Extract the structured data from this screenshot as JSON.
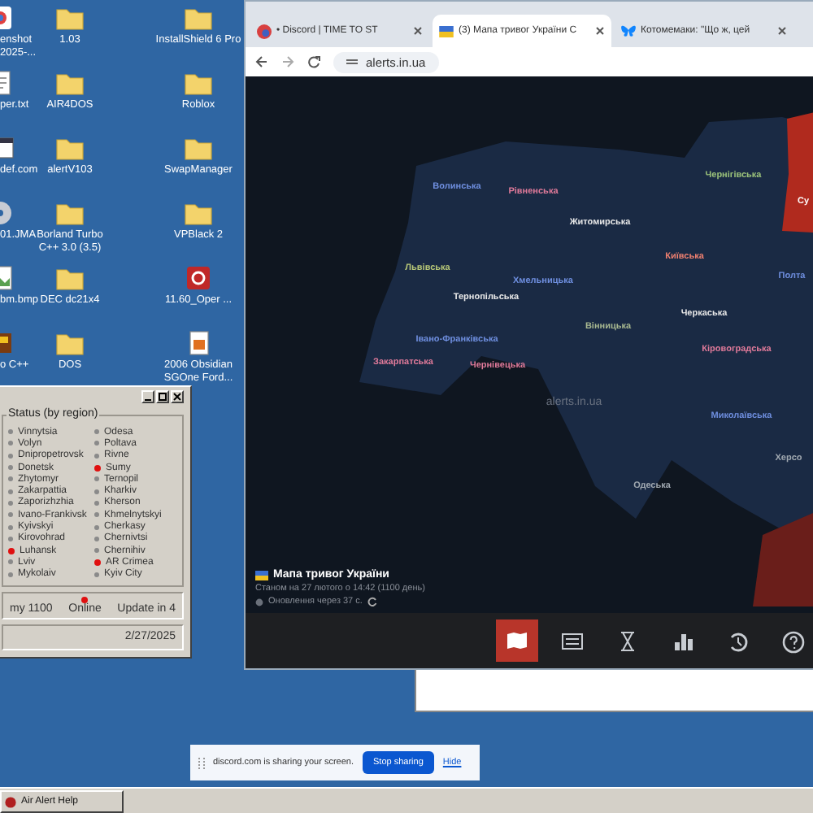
{
  "desktop_icons": [
    {
      "label": "enshot 2025-...",
      "kind": "screenshot"
    },
    {
      "label": "per.txt",
      "kind": "text"
    },
    {
      "label": "def.com",
      "kind": "program"
    },
    {
      "label": "01.JMA",
      "kind": "disc"
    },
    {
      "label": "bm.bmp",
      "kind": "image"
    },
    {
      "label": "o C++",
      "kind": "game"
    },
    {
      "label": "1.03",
      "kind": "folder"
    },
    {
      "label": "AIR4DOS",
      "kind": "folder"
    },
    {
      "label": "alertV103",
      "kind": "folder"
    },
    {
      "label": "Borland Turbo C++ 3.0 (3.5)",
      "kind": "folder"
    },
    {
      "label": "DEC dc21x4",
      "kind": "folder"
    },
    {
      "label": "DOS",
      "kind": "folder"
    },
    {
      "label": "InstallShield 6 Pro",
      "kind": "folder"
    },
    {
      "label": "Roblox",
      "kind": "folder"
    },
    {
      "label": "SwapManager",
      "kind": "folder"
    },
    {
      "label": "VPBlack 2",
      "kind": "folder"
    },
    {
      "label": "11.60_Oper ...",
      "kind": "redapp"
    },
    {
      "label": "2006 Obsidian SGOne Ford...",
      "kind": "document"
    }
  ],
  "alert_window": {
    "group_title": "Status (by region)",
    "regions": [
      {
        "name": "Vinnytsia",
        "alert": false
      },
      {
        "name": "Volyn",
        "alert": false
      },
      {
        "name": "Dnipropetrovsk",
        "alert": false
      },
      {
        "name": "Donetsk",
        "alert": false
      },
      {
        "name": "Zhytomyr",
        "alert": false
      },
      {
        "name": "Zakarpattia",
        "alert": false
      },
      {
        "name": "Zaporizhzhia",
        "alert": false
      },
      {
        "name": "Ivano-Frankivsk",
        "alert": false
      },
      {
        "name": "Kyivskyi",
        "alert": false
      },
      {
        "name": "Kirovohrad",
        "alert": false
      },
      {
        "name": "Luhansk",
        "alert": true
      },
      {
        "name": "Lviv",
        "alert": false
      },
      {
        "name": "Mykolaiv",
        "alert": false
      },
      {
        "name": "Odesa",
        "alert": false
      },
      {
        "name": "Poltava",
        "alert": false
      },
      {
        "name": "Rivne",
        "alert": false
      },
      {
        "name": "Sumy",
        "alert": true
      },
      {
        "name": "Ternopil",
        "alert": false
      },
      {
        "name": "Kharkiv",
        "alert": false
      },
      {
        "name": "Kherson",
        "alert": false
      },
      {
        "name": "Khmelnytskyi",
        "alert": false
      },
      {
        "name": "Cherkasy",
        "alert": false
      },
      {
        "name": "Chernivtsi",
        "alert": false
      },
      {
        "name": "Chernihiv",
        "alert": false
      },
      {
        "name": "AR Crimea",
        "alert": true
      },
      {
        "name": "Kyiv City",
        "alert": false
      }
    ],
    "day_text": "my 1100",
    "online_label": "Online",
    "online": true,
    "update_text": "Update in 4",
    "date": "2/27/2025"
  },
  "browser": {
    "tabs": [
      {
        "title": "• Discord | TIME TO ST",
        "selected": false,
        "kind": "discord"
      },
      {
        "title": "(3) Мапа тривог України С",
        "selected": true,
        "kind": "alerts"
      },
      {
        "title": "Котомемаки: \"Що ж, цей",
        "selected": false,
        "kind": "bluesky"
      }
    ],
    "address": "alerts.in.ua",
    "map_labels": [
      {
        "text": "Волинська",
        "color": "#6f8fe0"
      },
      {
        "text": "Рівненська",
        "color": "#e07a9a"
      },
      {
        "text": "Житомирська",
        "color": "#e8e8e8"
      },
      {
        "text": "Київська",
        "color": "#f08070"
      },
      {
        "text": "Чернігівська",
        "color": "#9bc27a"
      },
      {
        "text": "Львівська",
        "color": "#b8c878"
      },
      {
        "text": "Хмельницька",
        "color": "#6f8fe0"
      },
      {
        "text": "Тернопільська",
        "color": "#e8e8e8"
      },
      {
        "text": "Вінницька",
        "color": "#a8b890"
      },
      {
        "text": "Черкаська",
        "color": "#e8e8e8"
      },
      {
        "text": "Івано-Франківська",
        "color": "#6f8fe0"
      },
      {
        "text": "Закарпатська",
        "color": "#e07a9a"
      },
      {
        "text": "Чернівецька",
        "color": "#e07a9a"
      },
      {
        "text": "Кіровоградська",
        "color": "#e07a9a"
      },
      {
        "text": "Миколаївська",
        "color": "#6f8fe0"
      },
      {
        "text": "Одеська",
        "color": "#a0a8b0"
      },
      {
        "text": "Полта",
        "color": "#6f8fe0"
      },
      {
        "text": "Херсо",
        "color": "#a0a8b0"
      },
      {
        "text": "Су",
        "color": "#ffffff"
      }
    ],
    "map_watermark": "alerts.in.ua",
    "info_title": "Мапа тривог України",
    "info_date": "Станом на 27 лютого о 14:42 (1100 день)",
    "info_update": "Оновлення через 37 с.",
    "toolbar": [
      {
        "kind": "map",
        "selected": true
      },
      {
        "kind": "list",
        "selected": false
      },
      {
        "kind": "timer",
        "selected": false
      },
      {
        "kind": "stats",
        "selected": false
      },
      {
        "kind": "history",
        "selected": false
      },
      {
        "kind": "help",
        "selected": false
      }
    ]
  },
  "share_bar": {
    "text": "discord.com is sharing your screen.",
    "stop_button": "Stop sharing",
    "hide_link": "Hide"
  },
  "taskbar": {
    "button": "Air Alert Help"
  }
}
